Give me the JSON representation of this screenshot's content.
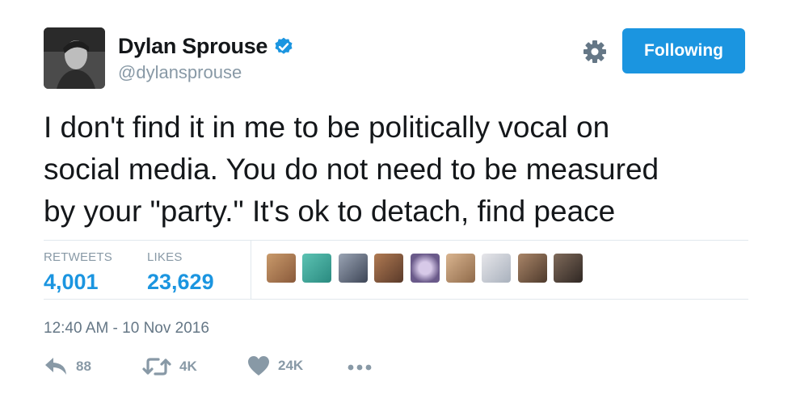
{
  "author": {
    "display_name": "Dylan Sprouse",
    "handle": "@dylansprouse",
    "verified": true
  },
  "header": {
    "follow_button_label": "Following"
  },
  "tweet": {
    "text": "I don't find it in me to be politically vocal on\nsocial media. You do not need to be measured\nby your \"party.\" It's ok to detach, find peace",
    "timestamp": "12:40 AM - 10 Nov 2016"
  },
  "stats": {
    "retweets_label": "RETWEETS",
    "retweets_value": "4,001",
    "likes_label": "LIKES",
    "likes_value": "23,629"
  },
  "liked_by_avatar_count": 9,
  "actions": {
    "reply_count": "88",
    "retweet_count": "4K",
    "like_count": "24K"
  },
  "colors": {
    "accent": "#1b95e0",
    "muted": "#8899a6",
    "text": "#14171a"
  },
  "icons": [
    "verified-badge-icon",
    "gear-icon",
    "reply-icon",
    "retweet-icon",
    "heart-icon",
    "more-icon"
  ]
}
